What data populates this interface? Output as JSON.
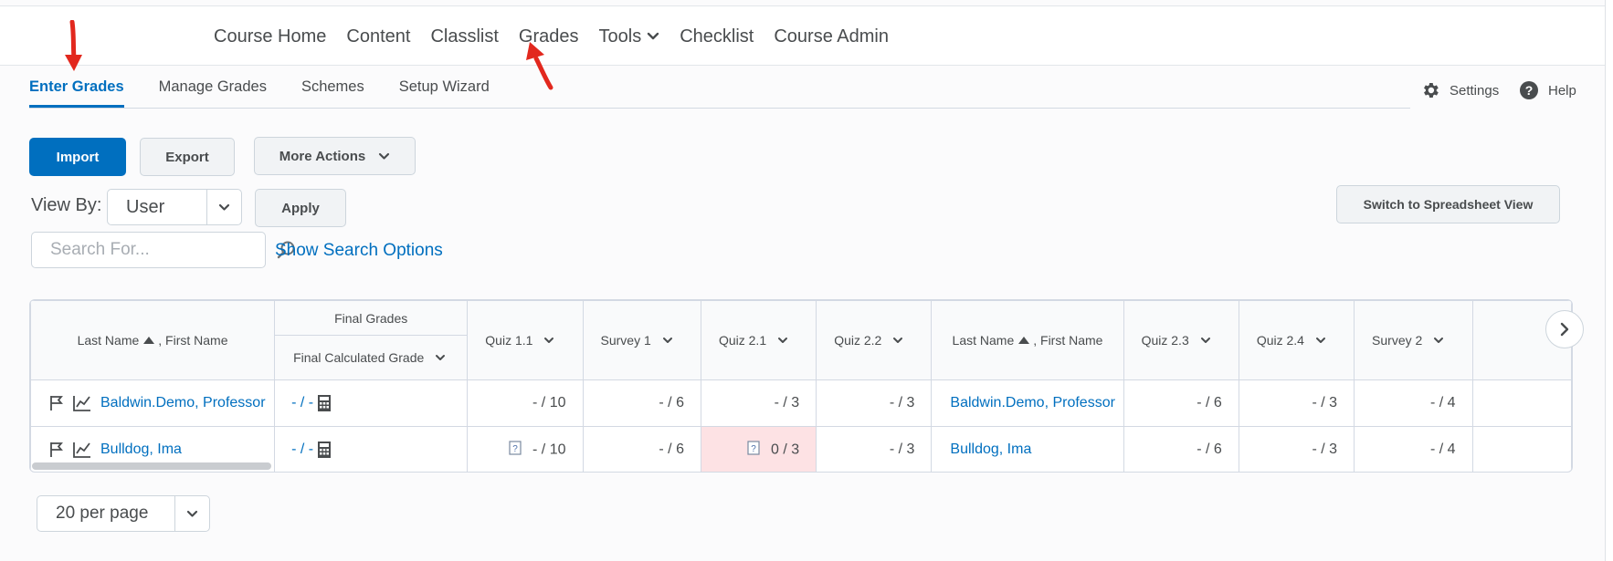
{
  "nav": {
    "items": [
      {
        "label": "Course Home"
      },
      {
        "label": "Content"
      },
      {
        "label": "Classlist"
      },
      {
        "label": "Grades"
      },
      {
        "label": "Tools"
      },
      {
        "label": "Checklist"
      },
      {
        "label": "Course Admin"
      }
    ]
  },
  "subnav": {
    "tabs": [
      {
        "label": "Enter Grades",
        "active": true
      },
      {
        "label": "Manage Grades"
      },
      {
        "label": "Schemes"
      },
      {
        "label": "Setup Wizard"
      }
    ],
    "settings": "Settings",
    "help": "Help"
  },
  "actions": {
    "import": "Import",
    "export": "Export",
    "more_actions": "More Actions",
    "view_by_label": "View By:",
    "view_by_value": "User",
    "apply": "Apply",
    "switch_view": "Switch to Spreadsheet View",
    "search_placeholder": "Search For...",
    "show_search_options": "Show Search Options"
  },
  "grid": {
    "name_header_last": "Last Name",
    "name_header_first": ", First Name",
    "final_group": "Final Grades",
    "final_calc": "Final Calculated Grade",
    "columns": [
      "Quiz 1.1",
      "Survey 1",
      "Quiz 2.1",
      "Quiz 2.2",
      "Quiz 2.3",
      "Quiz 2.4",
      "Survey 2"
    ],
    "rows": [
      {
        "name": "Baldwin.Demo, Professor",
        "final": "- / -",
        "q11": "- / 10",
        "s1": "- / 6",
        "q21": "- / 3",
        "q22": "- / 3",
        "q23": "- / 6",
        "q24": "- / 3",
        "s2": "- / 4"
      },
      {
        "name": "Bulldog, Ima",
        "final": "- / -",
        "q11": "- / 10",
        "s1": "- / 6",
        "q21": "0 / 3",
        "q22": "- / 3",
        "q23": "- / 6",
        "q24": "- / 3",
        "s2": "- / 4"
      }
    ]
  },
  "pagination": {
    "per_page": "20 per page"
  },
  "colors": {
    "accent": "#006fbf",
    "error_cell": "#fde2e4",
    "annotation_arrow": "#e2281e"
  }
}
